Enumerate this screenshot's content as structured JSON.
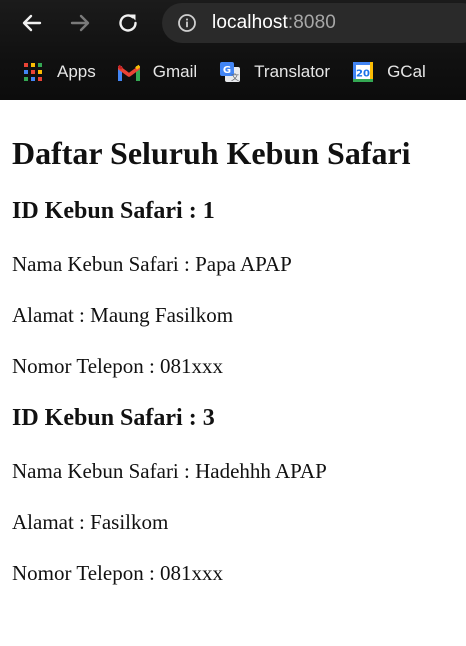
{
  "browser": {
    "url_host": "localhost",
    "url_port": ":8080",
    "bookmarks": [
      {
        "label": "Apps",
        "icon": "apps-grid-icon"
      },
      {
        "label": "Gmail",
        "icon": "gmail-icon"
      },
      {
        "label": "Translator",
        "icon": "translate-icon"
      },
      {
        "label": "GCal",
        "icon": "calendar-icon",
        "badge": "20"
      }
    ]
  },
  "page": {
    "title": "Daftar Seluruh Kebun Safari",
    "safaris": [
      {
        "heading": "ID Kebun Safari : 1",
        "name": "Nama Kebun Safari : Papa APAP",
        "address": "Alamat : Maung Fasilkom",
        "phone": "Nomor Telepon : 081xxx"
      },
      {
        "heading": "ID Kebun Safari : 3",
        "name": "Nama Kebun Safari : Hadehhh APAP",
        "address": "Alamat : Fasilkom",
        "phone": "Nomor Telepon : 081xxx"
      }
    ]
  }
}
